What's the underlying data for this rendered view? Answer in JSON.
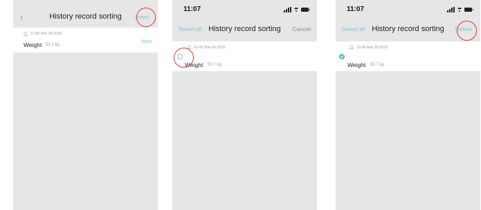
{
  "screens": [
    {
      "nav": {
        "back_glyph": "‹",
        "title": "History record sorting",
        "right": "Select"
      },
      "record": {
        "timestamp": "11:00 Mar.30,2020",
        "label": "Weight",
        "value": "52.1 kg",
        "action": "claim"
      }
    },
    {
      "status": {
        "time": "11:07"
      },
      "nav": {
        "left": "Select all",
        "title": "History record sorting",
        "right": "Cancel"
      },
      "record": {
        "timestamp": "11:06 Mar.30,2020",
        "label": "Weight",
        "value": "50.7 kg",
        "selected": false
      }
    },
    {
      "status": {
        "time": "11:07"
      },
      "nav": {
        "left": "Select all",
        "title": "History record sorting",
        "right": "Delete"
      },
      "record": {
        "timestamp": "11:06 Mar.30,2020",
        "label": "Weight",
        "value": "50.7 kg",
        "selected": true
      }
    }
  ],
  "icons": [
    "chevron-left-icon",
    "bell-icon",
    "signal-icon",
    "wifi-icon",
    "battery-icon",
    "checkmark-icon"
  ],
  "colors": {
    "accent": "#7cc7d8",
    "highlight_ring": "#d93a2b",
    "background": "#e6e6e6"
  }
}
